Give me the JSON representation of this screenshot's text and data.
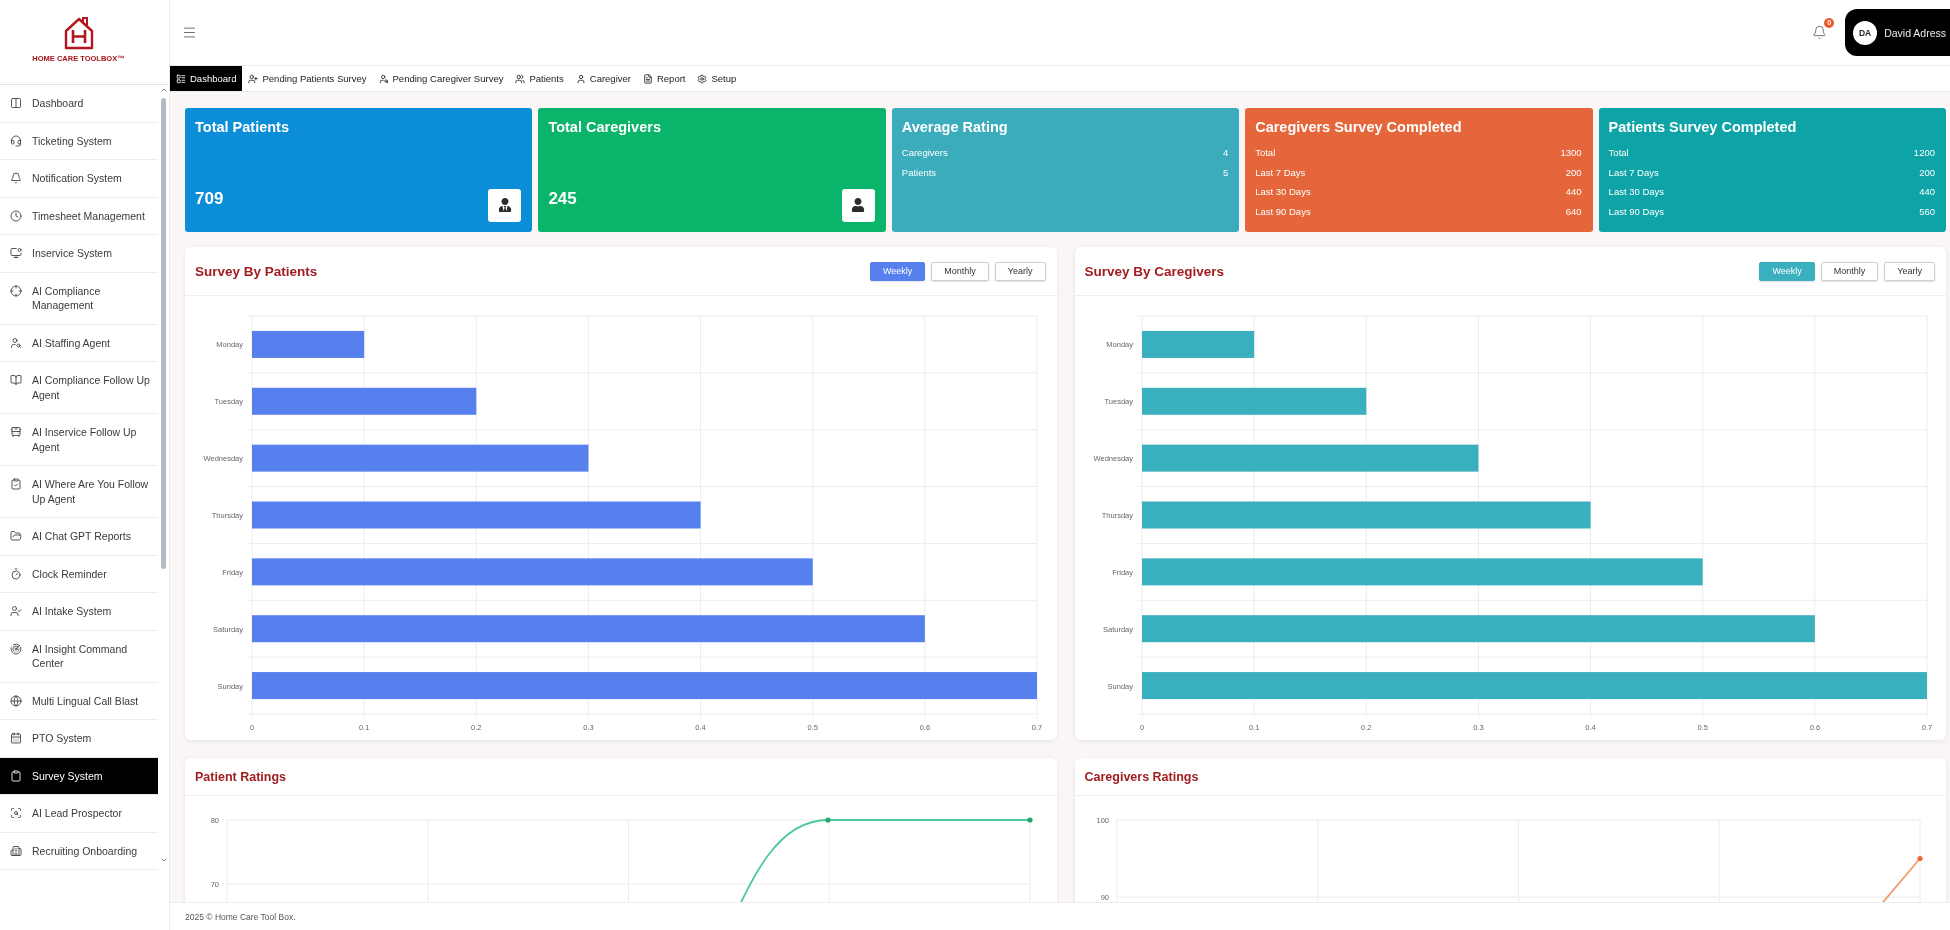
{
  "sidebar": {
    "brand": "HOME CARE TOOLBOX™",
    "items": [
      {
        "label": "Dashboard",
        "selected": false
      },
      {
        "label": "Ticketing System",
        "selected": false
      },
      {
        "label": "Notification System",
        "selected": false
      },
      {
        "label": "Timesheet Management",
        "selected": false
      },
      {
        "label": "Inservice System",
        "selected": false
      },
      {
        "label": "AI Compliance Management",
        "selected": false
      },
      {
        "label": "AI Staffing Agent",
        "selected": false
      },
      {
        "label": "AI Compliance Follow Up Agent",
        "selected": false
      },
      {
        "label": "AI Inservice Follow Up Agent",
        "selected": false
      },
      {
        "label": "AI Where Are You Follow Up Agent",
        "selected": false
      },
      {
        "label": "AI Chat GPT Reports",
        "selected": false
      },
      {
        "label": "Clock Reminder",
        "selected": false
      },
      {
        "label": "AI Intake System",
        "selected": false
      },
      {
        "label": "AI Insight Command Center",
        "selected": false
      },
      {
        "label": "Multi Lingual Call Blast",
        "selected": false
      },
      {
        "label": "PTO System",
        "selected": false
      },
      {
        "label": "Survey System",
        "selected": true
      },
      {
        "label": "AI Lead Prospector",
        "selected": false
      },
      {
        "label": "Recruiting Onboarding",
        "selected": false
      }
    ]
  },
  "header": {
    "notification_count": "0",
    "user": {
      "initials": "DA",
      "name": "David Adress"
    }
  },
  "nav_tabs": [
    {
      "label": "Dashboard",
      "selected": true
    },
    {
      "label": "Pending Patients Survey",
      "selected": false
    },
    {
      "label": "Pending Caregiver Survey",
      "selected": false
    },
    {
      "label": "Patients",
      "selected": false
    },
    {
      "label": "Caregiver",
      "selected": false
    },
    {
      "label": "Report",
      "selected": false
    },
    {
      "label": "Setup",
      "selected": false
    }
  ],
  "stat_cards": [
    {
      "kind": "total",
      "title": "Total Patients",
      "value": "709",
      "color": "#0b8ed7"
    },
    {
      "kind": "total",
      "title": "Total Caregivers",
      "value": "245",
      "color": "#0ab46a"
    },
    {
      "kind": "breakdown",
      "title": "Average Rating",
      "color": "#3aacbc",
      "rows": [
        {
          "label": "Caregivers",
          "value": "4"
        },
        {
          "label": "Patients",
          "value": "5"
        }
      ]
    },
    {
      "kind": "breakdown",
      "title": "Caregivers Survey Completed",
      "color": "#e5663b",
      "rows": [
        {
          "label": "Total",
          "value": "1300"
        },
        {
          "label": "Last 7 Days",
          "value": "200"
        },
        {
          "label": "Last 30 Days",
          "value": "440"
        },
        {
          "label": "Last 90 Days",
          "value": "640"
        }
      ]
    },
    {
      "kind": "breakdown",
      "title": "Patients Survey Completed",
      "color": "#0ea4a7",
      "rows": [
        {
          "label": "Total",
          "value": "1200"
        },
        {
          "label": "Last 7 Days",
          "value": "200"
        },
        {
          "label": "Last 30 Days",
          "value": "440"
        },
        {
          "label": "Last 90 Days",
          "value": "560"
        }
      ]
    }
  ],
  "survey_charts": [
    {
      "title": "Survey By Patients",
      "periods": [
        {
          "label": "Weekly",
          "selected": true
        },
        {
          "label": "Monthly",
          "selected": false
        },
        {
          "label": "Yearly",
          "selected": false
        }
      ],
      "chart_data": {
        "type": "bar",
        "orientation": "horizontal",
        "grid": true,
        "categories": [
          "Monday",
          "Tuesday",
          "Wednesday",
          "Thursday",
          "Friday",
          "Saturday",
          "Sunday"
        ],
        "series": [
          {
            "color": "#5580ee",
            "values": [
              0.1,
              0.2,
              0.3,
              0.4,
              0.5,
              0.6,
              0.7
            ]
          }
        ],
        "xlim": [
          0,
          0.7
        ],
        "xticks": [
          0,
          0.1,
          0.2,
          0.3,
          0.4,
          0.5,
          0.6,
          0.7
        ]
      }
    },
    {
      "title": "Survey By Caregivers",
      "periods": [
        {
          "label": "Weekly",
          "selected": true
        },
        {
          "label": "Monthly",
          "selected": false
        },
        {
          "label": "Yearly",
          "selected": false
        }
      ],
      "chart_data": {
        "type": "bar",
        "orientation": "horizontal",
        "grid": true,
        "categories": [
          "Monday",
          "Tuesday",
          "Wednesday",
          "Thursday",
          "Friday",
          "Saturday",
          "Sunday"
        ],
        "series": [
          {
            "color": "#3aafbd",
            "values": [
              0.1,
              0.2,
              0.3,
              0.4,
              0.5,
              0.6,
              0.7
            ]
          }
        ],
        "xlim": [
          0,
          0.7
        ],
        "xticks": [
          0,
          0.1,
          0.2,
          0.3,
          0.4,
          0.5,
          0.6,
          0.7
        ]
      }
    }
  ],
  "rating_charts": [
    {
      "title": "Patient Ratings",
      "y_axis_labels": [
        "80",
        "70"
      ]
    },
    {
      "title": "Caregivers Ratings",
      "y_axis_labels": [
        "100",
        "90"
      ]
    }
  ],
  "footer": {
    "text": "2025 © Home Care Tool Box."
  }
}
